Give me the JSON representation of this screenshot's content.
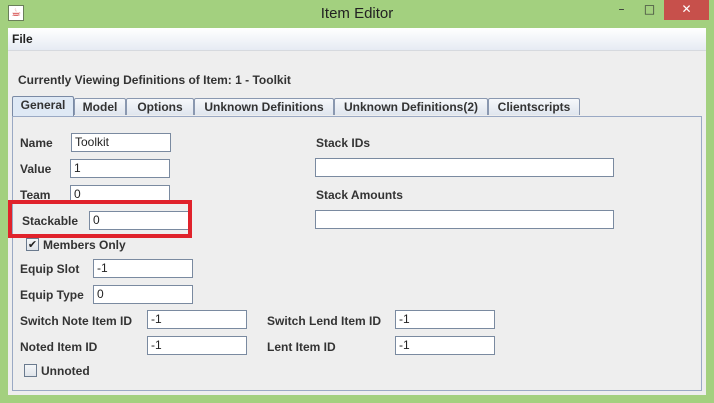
{
  "window": {
    "title": "Item Editor",
    "icon": "java-cup-icon",
    "controls": {
      "minimize": "–",
      "maximize": "□",
      "close": "✕"
    }
  },
  "menubar": {
    "file": "File"
  },
  "heading": "Currently Viewing Definitions of Item: 1 - Toolkit",
  "tabs": [
    "General",
    "Model",
    "Options",
    "Unknown Definitions",
    "Unknown Definitions(2)",
    "Clientscripts"
  ],
  "active_tab": "General",
  "fields": {
    "name": {
      "label": "Name",
      "value": "Toolkit"
    },
    "value": {
      "label": "Value",
      "value": "1"
    },
    "team": {
      "label": "Team",
      "value": "0"
    },
    "stackable": {
      "label": "Stackable",
      "value": "0"
    },
    "members_only": {
      "label": "Members Only",
      "checked": true
    },
    "equip_slot": {
      "label": "Equip Slot",
      "value": "-1"
    },
    "equip_type": {
      "label": "Equip Type",
      "value": "0"
    },
    "switch_note_item_id": {
      "label": "Switch Note Item ID",
      "value": "-1"
    },
    "switch_lend_item_id": {
      "label": "Switch Lend Item ID",
      "value": "-1"
    },
    "noted_item_id": {
      "label": "Noted Item ID",
      "value": "-1"
    },
    "lent_item_id": {
      "label": "Lent Item ID",
      "value": "-1"
    },
    "unnoted": {
      "label": "Unnoted",
      "checked": false
    },
    "stack_ids": {
      "label": "Stack IDs",
      "value": ""
    },
    "stack_amounts": {
      "label": "Stack Amounts",
      "value": ""
    }
  },
  "colors": {
    "highlight": "#e0222b",
    "titlebar": "#a3d07f",
    "close_button": "#c7504b"
  }
}
